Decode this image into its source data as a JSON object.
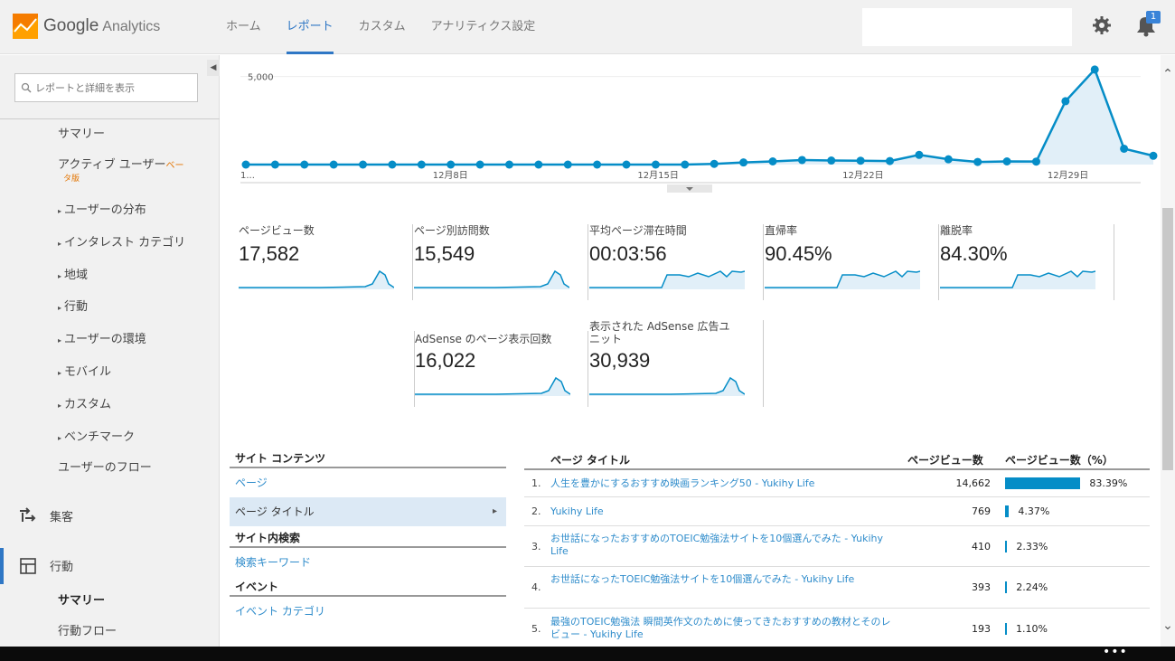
{
  "header": {
    "brand": "Google",
    "brand_sub": "Analytics",
    "tabs": [
      "ホーム",
      "レポート",
      "カスタム",
      "アナリティクス設定"
    ],
    "active_tab": "レポート",
    "notification_count": "1",
    "brand_colors": {
      "orange": "#f57c00",
      "yellow": "#ffa000",
      "accent": "#2f77c5"
    }
  },
  "sidebar": {
    "search_placeholder": "レポートと詳細を表示",
    "items": {
      "summary": "サマリー",
      "active_users": "アクティブ ユーザー",
      "active_users_beta1": "ベー",
      "active_users_beta2": "タ版",
      "user_distribution": "ユーザーの分布",
      "interests": "インタレスト カテゴリ",
      "geo": "地域",
      "behavior": "行動",
      "environment": "ユーザーの環境",
      "mobile": "モバイル",
      "custom": "カスタム",
      "benchmark": "ベンチマーク",
      "user_flow": "ユーザーのフロー",
      "acquisition": "集客",
      "behavior_section": "行動",
      "behavior_summary": "サマリー",
      "behavior_flow": "行動フロー"
    }
  },
  "chart_data": {
    "type": "area",
    "y_tick": "5,000",
    "x_labels": [
      "1...",
      "12月8日",
      "12月15日",
      "12月22日",
      "12月29日"
    ],
    "values": [
      0,
      0,
      0,
      0,
      0,
      0,
      0,
      0,
      0,
      0,
      0,
      0,
      0,
      0,
      0,
      0,
      40,
      120,
      180,
      260,
      230,
      220,
      200,
      550,
      300,
      150,
      180,
      170,
      3600,
      5400,
      900,
      500
    ],
    "ylim": [
      0,
      5600
    ],
    "line_color": "#058dc7",
    "fill_color": "#e1eff8"
  },
  "metrics": [
    {
      "label": "ページビュー数",
      "value": "17,582",
      "shape": "spike"
    },
    {
      "label": "ページ別訪問数",
      "value": "15,549",
      "shape": "spike"
    },
    {
      "label": "平均ページ滞在時間",
      "value": "00:03:56",
      "shape": "plateau"
    },
    {
      "label": "直帰率",
      "value": "90.45%",
      "shape": "plateau"
    },
    {
      "label": "離脱率",
      "value": "84.30%",
      "shape": "plateau"
    },
    {
      "label": "AdSense のページ表示回数",
      "value": "16,022",
      "shape": "spike"
    },
    {
      "label": "表示された AdSense 広告ユ\nニット",
      "value": "30,939",
      "shape": "spike"
    }
  ],
  "left_table": {
    "site_content_header": "サイト コンテンツ",
    "page_link": "ページ",
    "page_title_link": "ページ タイトル",
    "site_search_header": "サイト内検索",
    "search_keyword_link": "検索キーワード",
    "events_header": "イベント",
    "event_category_link": "イベント カテゴリ"
  },
  "right_table": {
    "col_title": "ページ タイトル",
    "col_pv": "ページビュー数",
    "col_pct": "ページビュー数（%）",
    "rows": [
      {
        "num": "1.",
        "title": "人生を豊かにするおすすめ映画ランキング50 - Yukihy Life",
        "pv": "14,662",
        "pct": "83.39%",
        "share": 83.39
      },
      {
        "num": "2.",
        "title": "Yukihy Life",
        "pv": "769",
        "pct": "4.37%",
        "share": 4.37
      },
      {
        "num": "3.",
        "title": "お世話になったおすすめのTOEIC勉強法サイトを10個選んでみた - Yukihy Life",
        "pv": "410",
        "pct": "2.33%",
        "share": 2.33
      },
      {
        "num": "4.",
        "title": "お世話になったTOEIC勉強法サイトを10個選んでみた - Yukihy Life",
        "pv": "393",
        "pct": "2.24%",
        "share": 2.24
      },
      {
        "num": "5.",
        "title": "最強のTOEIC勉強法 瞬間英作文のために使ってきたおすすめの教材とそのレビュー - Yukihy Life",
        "pv": "193",
        "pct": "1.10%",
        "share": 1.1
      }
    ]
  },
  "taskbar": {
    "dots": "•••"
  }
}
